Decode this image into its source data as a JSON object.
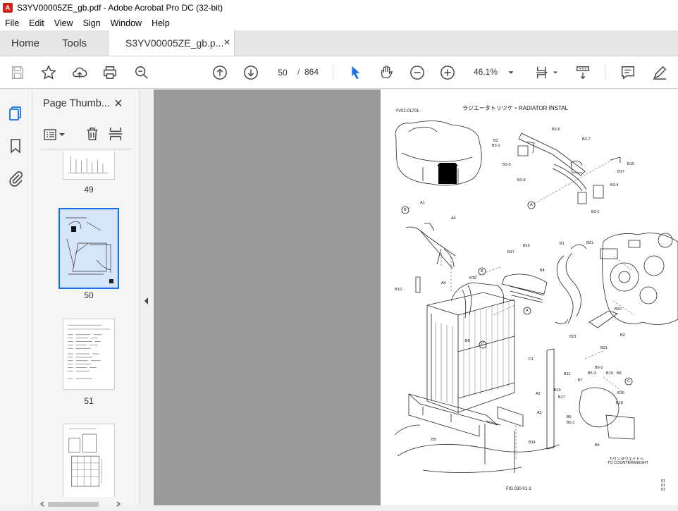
{
  "window": {
    "title": "S3YV00005ZE_gb.pdf - Adobe Acrobat Pro DC (32-bit)",
    "app_icon_text": "A"
  },
  "menu": [
    "File",
    "Edit",
    "View",
    "Sign",
    "Window",
    "Help"
  ],
  "tabs": {
    "home": "Home",
    "tools": "Tools",
    "document": "S3YV00005ZE_gb.p...",
    "close": "×"
  },
  "toolbar": {
    "page_current": "50",
    "page_separator": "/",
    "page_total": "864",
    "zoom": "46.1%"
  },
  "thumbnails_panel": {
    "title": "Page Thumb...",
    "close": "×",
    "pages": [
      {
        "label": "49"
      },
      {
        "label": "50",
        "selected": true
      },
      {
        "label": "51"
      },
      {
        "label": ""
      }
    ]
  },
  "document_page": {
    "title": "ラジエータトリツケ・RADIATOR INSTAL",
    "code": "YV02-01701-",
    "figure": "FIG 030-01-1",
    "corner": [
      "01",
      "01",
      "01"
    ],
    "note_jp": "カウンタウエイトへ",
    "note_en": "TO COUNTERWEIGHT",
    "callouts": [
      "A",
      "B",
      "C"
    ],
    "parts": [
      "B3-6",
      "B3",
      "B3-1",
      "B3-7",
      "B15",
      "B17",
      "B3-3",
      "B3-8",
      "B3-4",
      "B3-2",
      "A1",
      "A4",
      "B17",
      "B15",
      "B1",
      "B21",
      "B4",
      "B19",
      "B10",
      "A4",
      "B20",
      "B8",
      "B21",
      "B21",
      "B2",
      "C1",
      "B11",
      "B5-2",
      "B7",
      "B5-3",
      "B19",
      "B8",
      "B15",
      "B17",
      "B16",
      "B18",
      "A2",
      "A3",
      "B5",
      "B5-1",
      "B6",
      "B9",
      "B14"
    ]
  },
  "colors": {
    "accent": "#1473e6",
    "viewer_bg": "#9a9a9a",
    "acrobat_red": "#d4211c"
  },
  "icons": [
    "save-icon",
    "bookmark-star-icon",
    "upload-icon",
    "print-icon",
    "zoom-search-icon",
    "arrow-up-icon",
    "arrow-down-icon",
    "pointer-icon",
    "hand-icon",
    "zoom-out-icon",
    "zoom-in-icon",
    "fit-page-icon",
    "scroll-mode-icon",
    "comment-icon",
    "pen-icon"
  ]
}
